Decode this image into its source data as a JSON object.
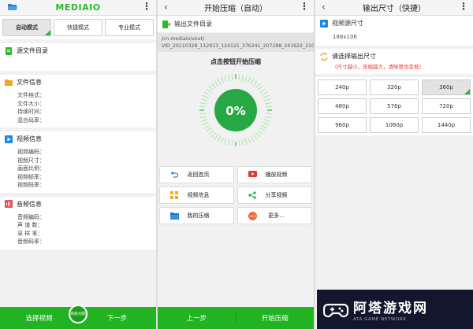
{
  "screen1": {
    "brand": "MEDIAIO",
    "modes": [
      "自动模式",
      "快捷模式",
      "专业模式"
    ],
    "source_dir_label": "源文件目录",
    "file_info": {
      "title": "文件信息",
      "rows": [
        "文件格式：",
        "文件大小：",
        "持续时间：",
        "混合码率："
      ]
    },
    "video_info": {
      "title": "视频信息",
      "rows": [
        "视频编码：",
        "视频尺寸：",
        "画面比例：",
        "视频帧率：",
        "视频码率："
      ]
    },
    "audio_info": {
      "title": "音频信息",
      "rows": [
        "音频编码：",
        "声 道 数：",
        "采 样 率：",
        "音频码率："
      ]
    },
    "bottom": {
      "left": "选择视频",
      "badge": "高级功能",
      "right": "下一步"
    }
  },
  "screen2": {
    "title": "开始压缩（自动）",
    "output_dir_label": "输出文件目录",
    "path": "/cn.mediaio/vout/\nVID_20210328_112913_124121_376241_207288_241922_2102",
    "start_hint": "点击按钮开始压缩",
    "progress_text": "0%",
    "progress": 0,
    "buttons": [
      "返回首页",
      "播放视频",
      "视频信息",
      "分享视频",
      "我的压缩",
      "更多..."
    ],
    "bottom": {
      "left": "上一步",
      "right": "开始压缩"
    }
  },
  "screen3": {
    "title": "输出尺寸（快捷）",
    "source_size_label": "视频源尺寸",
    "source_size_value": "188x106",
    "pick_label": "请选择输出尺寸",
    "pick_note": "（尺寸越小，压缩越大，清晰度也变低）",
    "resolutions": [
      "240p",
      "320p",
      "360p",
      "480p",
      "576p",
      "720p",
      "960p",
      "1080p",
      "1440p"
    ],
    "selected_resolution": "360p"
  },
  "watermark": {
    "name": "阿塔游戏网",
    "sub": "ATA GAME NETWORK"
  },
  "colors": {
    "accent": "#22b322",
    "warning": "#e53935",
    "video_blue": "#1e88e5",
    "file_orange": "#f5a623",
    "audio_red": "#e55353"
  }
}
